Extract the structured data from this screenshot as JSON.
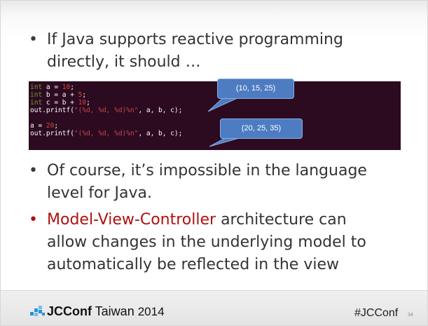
{
  "bullets": {
    "b1": {
      "line1": "If Java supports reactive programming",
      "line2": "directly, it should …"
    },
    "b2": {
      "line1": "Of course, it’s impossible in the language",
      "line2": "level for Java."
    },
    "b3": {
      "accent": "Model-View-Controller",
      "line1_rest": " architecture can",
      "line2": "allow changes in the underlying model to",
      "line3": "automatically be reflected in the view"
    },
    "marker": "•"
  },
  "code": {
    "l1": {
      "kw": "int",
      "pre": " a = ",
      "num": "10",
      "post": ";"
    },
    "l2": {
      "kw": "int",
      "pre": " b = a + ",
      "num": "5",
      "post": ";"
    },
    "l3": {
      "kw": "int",
      "pre": " c = b + ",
      "num": "10",
      "post": ";"
    },
    "l4": {
      "pre": "out.printf(",
      "str": "\"(%d, %d, %d)%n\"",
      "post": ", a, b, c);"
    },
    "l5": {
      "pre": "a = ",
      "num": "20",
      "post": ";"
    },
    "l6": {
      "pre": "out.printf(",
      "str": "\"(%d, %d, %d)%n\"",
      "post": ", a, b, c);"
    }
  },
  "callouts": {
    "first": "(10, 15, 25)",
    "second": "(20, 25, 35)"
  },
  "footer": {
    "logo_jc": "JCConf",
    "logo_rest": " Taiwan ",
    "logo_year": "2014",
    "hashtag": "#JCConf",
    "page_number": "34"
  },
  "colors": {
    "accent_red": "#b01010",
    "code_bg": "#2c0a1f",
    "callout_blue": "#4d7cc2"
  }
}
